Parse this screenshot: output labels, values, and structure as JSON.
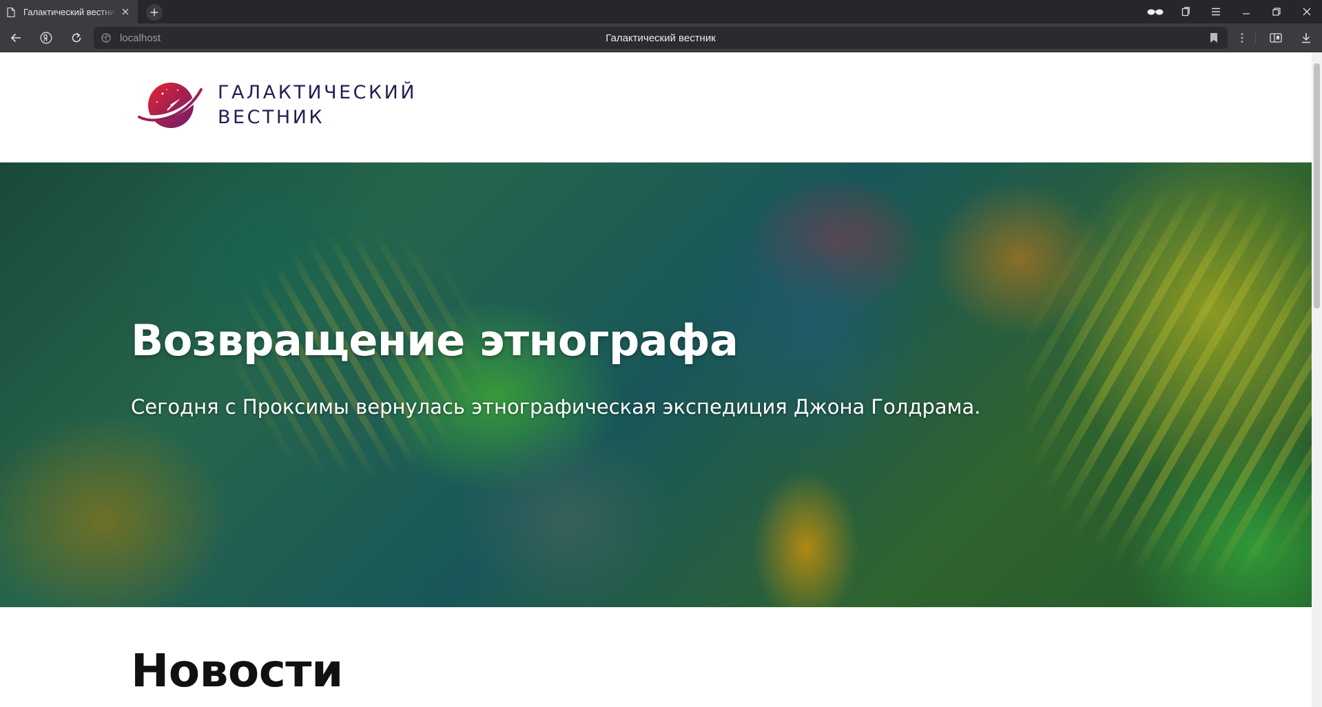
{
  "browser": {
    "tab": {
      "title": "Галактический вестник"
    },
    "address": {
      "url": "localhost",
      "page_title": "Галактический вестник"
    }
  },
  "site": {
    "logo": {
      "line1": "ГАЛАКТИЧЕСКИЙ",
      "line2": "ВЕСТНИК"
    },
    "hero": {
      "title": "Возвращение этнографа",
      "lead": "Сегодня с Проксимы вернулась этнографическая экспедиция Джона Голдрама."
    },
    "news": {
      "heading": "Новости"
    }
  },
  "colors": {
    "logo_text": "#2a1a54",
    "logo_planet_start": "#e3232f",
    "logo_planet_end": "#6a1e6e"
  }
}
